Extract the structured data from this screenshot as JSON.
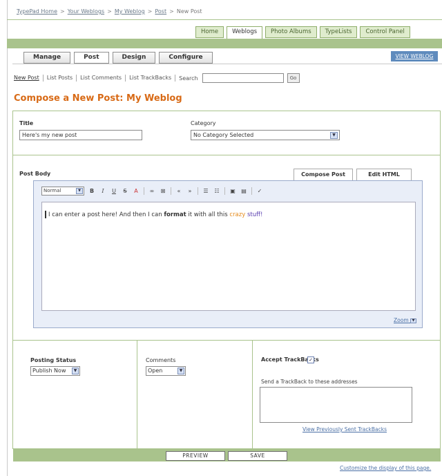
{
  "breadcrumb": {
    "items": [
      "TypePad Home",
      "Your Weblogs",
      "My Weblog",
      "Post"
    ],
    "current": "New Post",
    "separator": ">"
  },
  "main_tabs": [
    {
      "label": "Home",
      "active": false
    },
    {
      "label": "Weblogs",
      "active": true
    },
    {
      "label": "Photo Albums",
      "active": false
    },
    {
      "label": "TypeLists",
      "active": false
    },
    {
      "label": "Control Panel",
      "active": false
    }
  ],
  "section_tabs": [
    {
      "label": "Manage",
      "active": false
    },
    {
      "label": "Post",
      "active": true
    },
    {
      "label": "Design",
      "active": false
    },
    {
      "label": "Configure",
      "active": false
    }
  ],
  "view_site_label": "VIEW WEBLOG",
  "subnav": {
    "items": [
      "New Post",
      "List Posts",
      "List Comments",
      "List TrackBacks"
    ],
    "search_label": "Search",
    "search_value": "",
    "go_label": "Go"
  },
  "page_title": {
    "prefix": "Compose a New Post:",
    "name": "My Weblog"
  },
  "form": {
    "title_label": "Title",
    "title_value": "Here's my new post",
    "category_label": "Category",
    "category_value": "No Category Selected",
    "post_body_label": "Post Body",
    "tab_compose": "Compose Post",
    "tab_edit_html": "Edit HTML",
    "format_value": "Normal",
    "body_text_1": "I can enter a post here!  And then I can",
    "body_bold": "format",
    "body_text_2": "it with all this",
    "body_color_1": "crazy",
    "body_color_2": "stuff!",
    "zoom_label": "Zoom"
  },
  "toolbar": {
    "bold": "B",
    "italic": "I",
    "underline": "U",
    "strike": "S",
    "color": "A",
    "link": "∞",
    "unlink": "⊠",
    "indent_out": "«",
    "indent_in": "»",
    "list_bullet": "☰",
    "list_number": "☷",
    "image": "▣",
    "file": "▤",
    "spell": "✓"
  },
  "settings": {
    "posting_status_label": "Posting Status",
    "posting_status_value": "Publish Now",
    "comments_label": "Comments",
    "comments_value": "Open",
    "accept_trackbacks_label": "Accept TrackBacks",
    "accept_trackbacks_checked": true,
    "send_trackback_label": "Send a TrackBack to these addresses",
    "view_trackbacks_label": "View Previously Sent TrackBacks"
  },
  "actions": {
    "preview_label": "PREVIEW",
    "save_label": "SAVE",
    "customize_label": "Customize the display of this page."
  },
  "colors": {
    "accent_green": "#a9c38c",
    "title_orange": "#d86a16",
    "link_blue": "#4a6fa5",
    "view_site_blue": "#5f8bbd"
  }
}
